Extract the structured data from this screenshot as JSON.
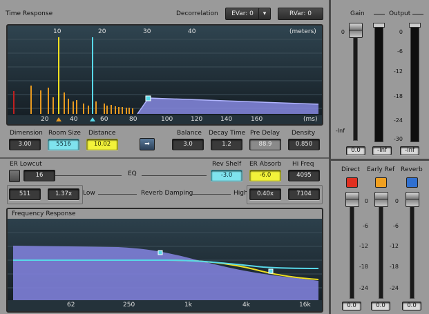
{
  "time_response": {
    "title": "Time Response",
    "decorrelation_label": "Decorrelation",
    "evar": "EVar: 0",
    "rvar": "RVar: 0",
    "meters_unit": "(meters)",
    "meters_ticks": [
      "10",
      "20",
      "30",
      "40"
    ],
    "ms_unit": "(ms)",
    "ms_ticks": [
      "20",
      "40",
      "60",
      "80",
      "100",
      "120",
      "140",
      "160"
    ],
    "params": {
      "dimension": {
        "label": "Dimension",
        "value": "3.00"
      },
      "room_size": {
        "label": "Room Size",
        "value": "5516"
      },
      "distance": {
        "label": "Distance",
        "value": "10.02"
      },
      "balance": {
        "label": "Balance",
        "value": "3.0"
      },
      "decay_time": {
        "label": "Decay Time",
        "value": "1.2"
      },
      "pre_delay": {
        "label": "Pre Delay",
        "value": "88.9"
      },
      "density": {
        "label": "Density",
        "value": "0.850"
      }
    }
  },
  "eq": {
    "er_lowcut_label": "ER Lowcut",
    "er_lowcut_value": "16",
    "eq_label": "EQ",
    "rev_shelf_label": "Rev Shelf",
    "rev_shelf_value": "-3.0",
    "er_absorb_label": "ER Absorb",
    "er_absorb_value": "-6.0",
    "hi_freq_label": "Hi Freq",
    "hi_freq_value": "4095",
    "low_freq_value": "511",
    "low_mult_value": "1.37x",
    "low_label": "Low",
    "reverb_damping_label": "Reverb Damping",
    "high_label": "High",
    "high_mult_value": "0.40x",
    "high_freq_value": "7104"
  },
  "frequency_response": {
    "title": "Frequency Response",
    "ticks": [
      "62",
      "250",
      "1k",
      "4k",
      "16k"
    ]
  },
  "gain_output": {
    "gain_label": "Gain",
    "output_label": "Output",
    "scale": [
      "0",
      "-6",
      "-12",
      "-18",
      "-24",
      "-30",
      "-Inf"
    ],
    "gain_value": "0.0",
    "out_left": "-Inf",
    "out_right": "-Inf"
  },
  "mix": {
    "direct_label": "Direct",
    "early_ref_label": "Early Ref",
    "reverb_label": "Reverb",
    "scale": [
      "0",
      "-6",
      "-12",
      "-18",
      "-24"
    ],
    "direct_value": "0.0",
    "early_ref_value": "0.0",
    "reverb_value": "0.0",
    "colors": {
      "direct": "#e03020",
      "early_ref": "#f0a020",
      "reverb": "#3070d0"
    }
  },
  "colors": {
    "cyan": "#58d8e8",
    "yellow": "#f0e020",
    "orange": "#e89a20",
    "purple": "#7e80d8"
  }
}
